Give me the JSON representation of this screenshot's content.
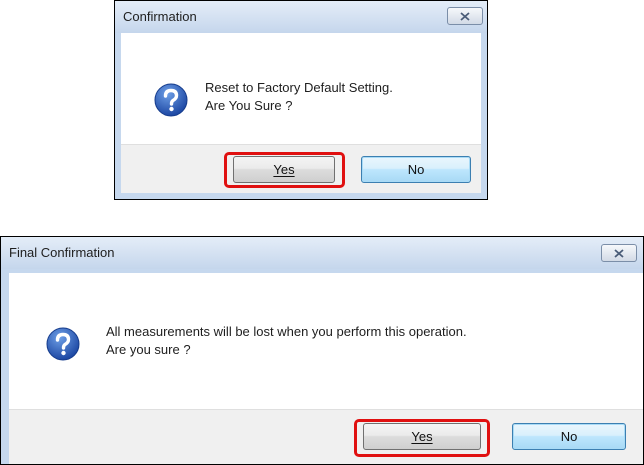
{
  "dialog1": {
    "title": "Confirmation",
    "message_line1": "Reset to Factory Default Setting.",
    "message_line2": "Are You Sure ?",
    "yes_label": "Yes",
    "no_label": "No",
    "icon": "question-icon"
  },
  "dialog2": {
    "title": "Final Confirmation",
    "message_line1": "All measurements will be lost when you perform this operation.",
    "message_line2": "Are you sure ?",
    "yes_label": "Yes",
    "no_label": "No",
    "icon": "question-icon"
  },
  "colors": {
    "highlight": "#e01010",
    "frame": "#c6d8ee",
    "default_button": "#bee6fd"
  }
}
